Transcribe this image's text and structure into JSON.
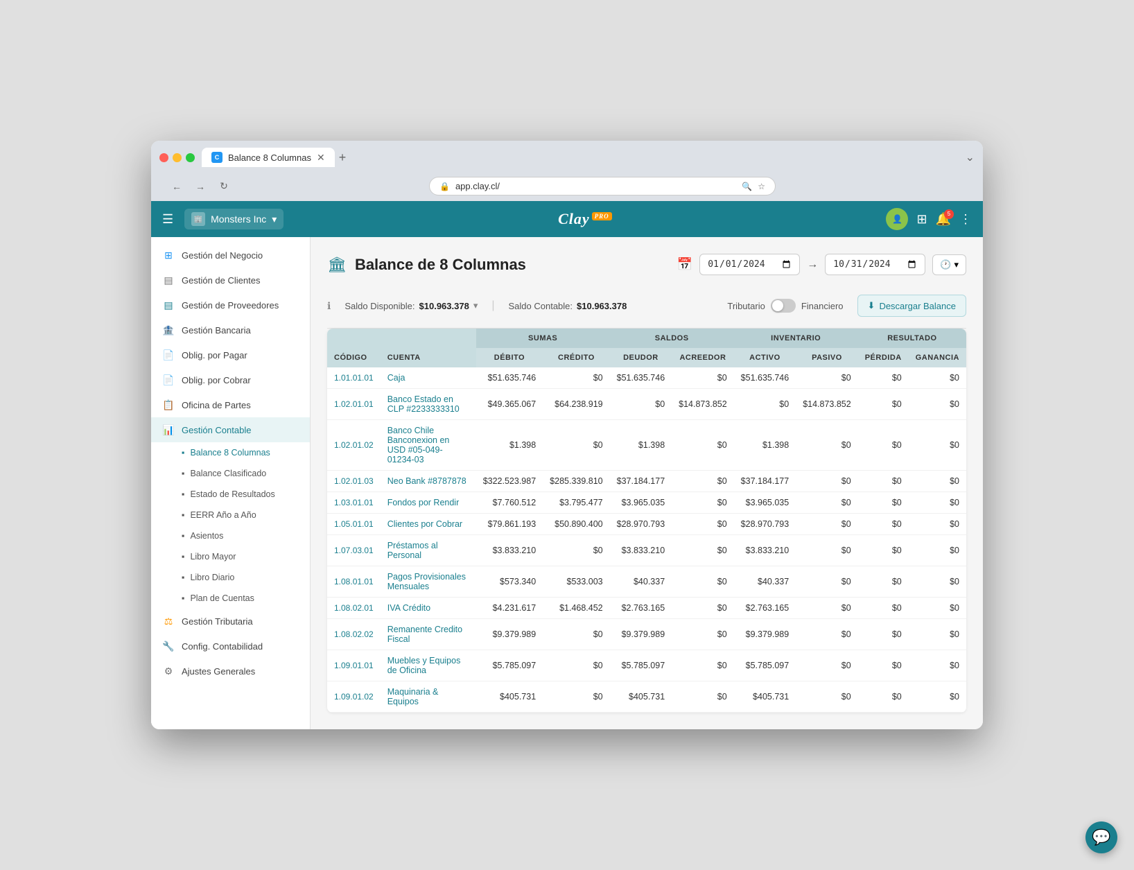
{
  "browser": {
    "tab_label": "Balance 8 Columnas",
    "tab_icon": "C",
    "url": "app.clay.cl/"
  },
  "nav": {
    "menu_icon": "☰",
    "company": "Monsters Inc",
    "logo": "Clay",
    "pro": "PRO",
    "avatar_initial": "U"
  },
  "sidebar": {
    "items": [
      {
        "id": "gestion-negocio",
        "label": "Gestión del Negocio",
        "icon": "⊞",
        "icon_color": "blue"
      },
      {
        "id": "gestion-clientes",
        "label": "Gestión de Clientes",
        "icon": "▤",
        "icon_color": "gray"
      },
      {
        "id": "gestion-proveedores",
        "label": "Gestión de Proveedores",
        "icon": "▤",
        "icon_color": "teal"
      },
      {
        "id": "gestion-bancaria",
        "label": "Gestión Bancaria",
        "icon": "🏦",
        "icon_color": "red"
      },
      {
        "id": "oblig-pagar",
        "label": "Oblig. por Pagar",
        "icon": "📄",
        "icon_color": "gray"
      },
      {
        "id": "oblig-cobrar",
        "label": "Oblig. por Cobrar",
        "icon": "📄",
        "icon_color": "gray"
      },
      {
        "id": "oficina-partes",
        "label": "Oficina de Partes",
        "icon": "📋",
        "icon_color": "gray"
      },
      {
        "id": "gestion-contable",
        "label": "Gestión Contable",
        "icon": "📊",
        "icon_color": "pink",
        "active": true
      },
      {
        "id": "balance-8-col",
        "label": "Balance 8 Columnas",
        "sub": true,
        "active": true
      },
      {
        "id": "balance-clasif",
        "label": "Balance Clasificado",
        "sub": true
      },
      {
        "id": "estado-resultados",
        "label": "Estado de Resultados",
        "sub": true
      },
      {
        "id": "eerr-anio",
        "label": "EERR Año a Año",
        "sub": true
      },
      {
        "id": "asientos",
        "label": "Asientos",
        "sub": true
      },
      {
        "id": "libro-mayor",
        "label": "Libro Mayor",
        "sub": true
      },
      {
        "id": "libro-diario",
        "label": "Libro Diario",
        "sub": true
      },
      {
        "id": "plan-cuentas",
        "label": "Plan de Cuentas",
        "sub": true
      },
      {
        "id": "gestion-tributaria",
        "label": "Gestión Tributaria",
        "icon": "⚖",
        "icon_color": "orange"
      },
      {
        "id": "config-contabilidad",
        "label": "Config. Contabilidad",
        "icon": "🔧",
        "icon_color": "red"
      },
      {
        "id": "ajustes-generales",
        "label": "Ajustes Generales",
        "icon": "⚙",
        "icon_color": "gray"
      }
    ]
  },
  "page": {
    "title": "Balance de 8 Columnas",
    "date_from": "01/01/2024",
    "date_to": "31/10/2024",
    "saldo_disponible_label": "Saldo Disponible:",
    "saldo_disponible_value": "$10.963.378",
    "saldo_contable_label": "Saldo Contable:",
    "saldo_contable_value": "$10.963.378",
    "toggle_left": "Tributario",
    "toggle_right": "Financiero",
    "download_btn": "Descargar Balance"
  },
  "table": {
    "col_groups": [
      {
        "label": "",
        "colspan": 2
      },
      {
        "label": "SUMAS",
        "colspan": 2
      },
      {
        "label": "SALDOS",
        "colspan": 2
      },
      {
        "label": "INVENTARIO",
        "colspan": 2
      },
      {
        "label": "RESULTADO",
        "colspan": 2
      }
    ],
    "cols": [
      "CÓDIGO",
      "CUENTA",
      "DÉBITO",
      "CRÉDITO",
      "DEUDOR",
      "ACREEDOR",
      "ACTIVO",
      "PASIVO",
      "PÉRDIDA",
      "GANANCIA"
    ],
    "rows": [
      {
        "codigo": "1.01.01.01",
        "cuenta": "Caja",
        "debito": "$51.635.746",
        "credito": "$0",
        "deudor": "$51.635.746",
        "acreedor": "$0",
        "activo": "$51.635.746",
        "pasivo": "$0",
        "perdida": "$0",
        "ganancia": "$0"
      },
      {
        "codigo": "1.02.01.01",
        "cuenta": "Banco Estado en CLP #2233333310",
        "debito": "$49.365.067",
        "credito": "$64.238.919",
        "deudor": "$0",
        "acreedor": "$14.873.852",
        "activo": "$0",
        "pasivo": "$14.873.852",
        "perdida": "$0",
        "ganancia": "$0"
      },
      {
        "codigo": "1.02.01.02",
        "cuenta": "Banco Chile Banconexion en USD #05-049-01234-03",
        "debito": "$1.398",
        "credito": "$0",
        "deudor": "$1.398",
        "acreedor": "$0",
        "activo": "$1.398",
        "pasivo": "$0",
        "perdida": "$0",
        "ganancia": "$0"
      },
      {
        "codigo": "1.02.01.03",
        "cuenta": "Neo Bank #8787878",
        "debito": "$322.523.987",
        "credito": "$285.339.810",
        "deudor": "$37.184.177",
        "acreedor": "$0",
        "activo": "$37.184.177",
        "pasivo": "$0",
        "perdida": "$0",
        "ganancia": "$0"
      },
      {
        "codigo": "1.03.01.01",
        "cuenta": "Fondos por Rendir",
        "debito": "$7.760.512",
        "credito": "$3.795.477",
        "deudor": "$3.965.035",
        "acreedor": "$0",
        "activo": "$3.965.035",
        "pasivo": "$0",
        "perdida": "$0",
        "ganancia": "$0"
      },
      {
        "codigo": "1.05.01.01",
        "cuenta": "Clientes por Cobrar",
        "debito": "$79.861.193",
        "credito": "$50.890.400",
        "deudor": "$28.970.793",
        "acreedor": "$0",
        "activo": "$28.970.793",
        "pasivo": "$0",
        "perdida": "$0",
        "ganancia": "$0"
      },
      {
        "codigo": "1.07.03.01",
        "cuenta": "Préstamos al Personal",
        "debito": "$3.833.210",
        "credito": "$0",
        "deudor": "$3.833.210",
        "acreedor": "$0",
        "activo": "$3.833.210",
        "pasivo": "$0",
        "perdida": "$0",
        "ganancia": "$0"
      },
      {
        "codigo": "1.08.01.01",
        "cuenta": "Pagos Provisionales Mensuales",
        "debito": "$573.340",
        "credito": "$533.003",
        "deudor": "$40.337",
        "acreedor": "$0",
        "activo": "$40.337",
        "pasivo": "$0",
        "perdida": "$0",
        "ganancia": "$0"
      },
      {
        "codigo": "1.08.02.01",
        "cuenta": "IVA Crédito",
        "debito": "$4.231.617",
        "credito": "$1.468.452",
        "deudor": "$2.763.165",
        "acreedor": "$0",
        "activo": "$2.763.165",
        "pasivo": "$0",
        "perdida": "$0",
        "ganancia": "$0"
      },
      {
        "codigo": "1.08.02.02",
        "cuenta": "Remanente Credito Fiscal",
        "debito": "$9.379.989",
        "credito": "$0",
        "deudor": "$9.379.989",
        "acreedor": "$0",
        "activo": "$9.379.989",
        "pasivo": "$0",
        "perdida": "$0",
        "ganancia": "$0"
      },
      {
        "codigo": "1.09.01.01",
        "cuenta": "Muebles y Equipos de Oficina",
        "debito": "$5.785.097",
        "credito": "$0",
        "deudor": "$5.785.097",
        "acreedor": "$0",
        "activo": "$5.785.097",
        "pasivo": "$0",
        "perdida": "$0",
        "ganancia": "$0"
      },
      {
        "codigo": "1.09.01.02",
        "cuenta": "Maquinaria & Equipos",
        "debito": "$405.731",
        "credito": "$0",
        "deudor": "$405.731",
        "acreedor": "$0",
        "activo": "$405.731",
        "pasivo": "$0",
        "perdida": "$0",
        "ganancia": "$0"
      }
    ]
  }
}
